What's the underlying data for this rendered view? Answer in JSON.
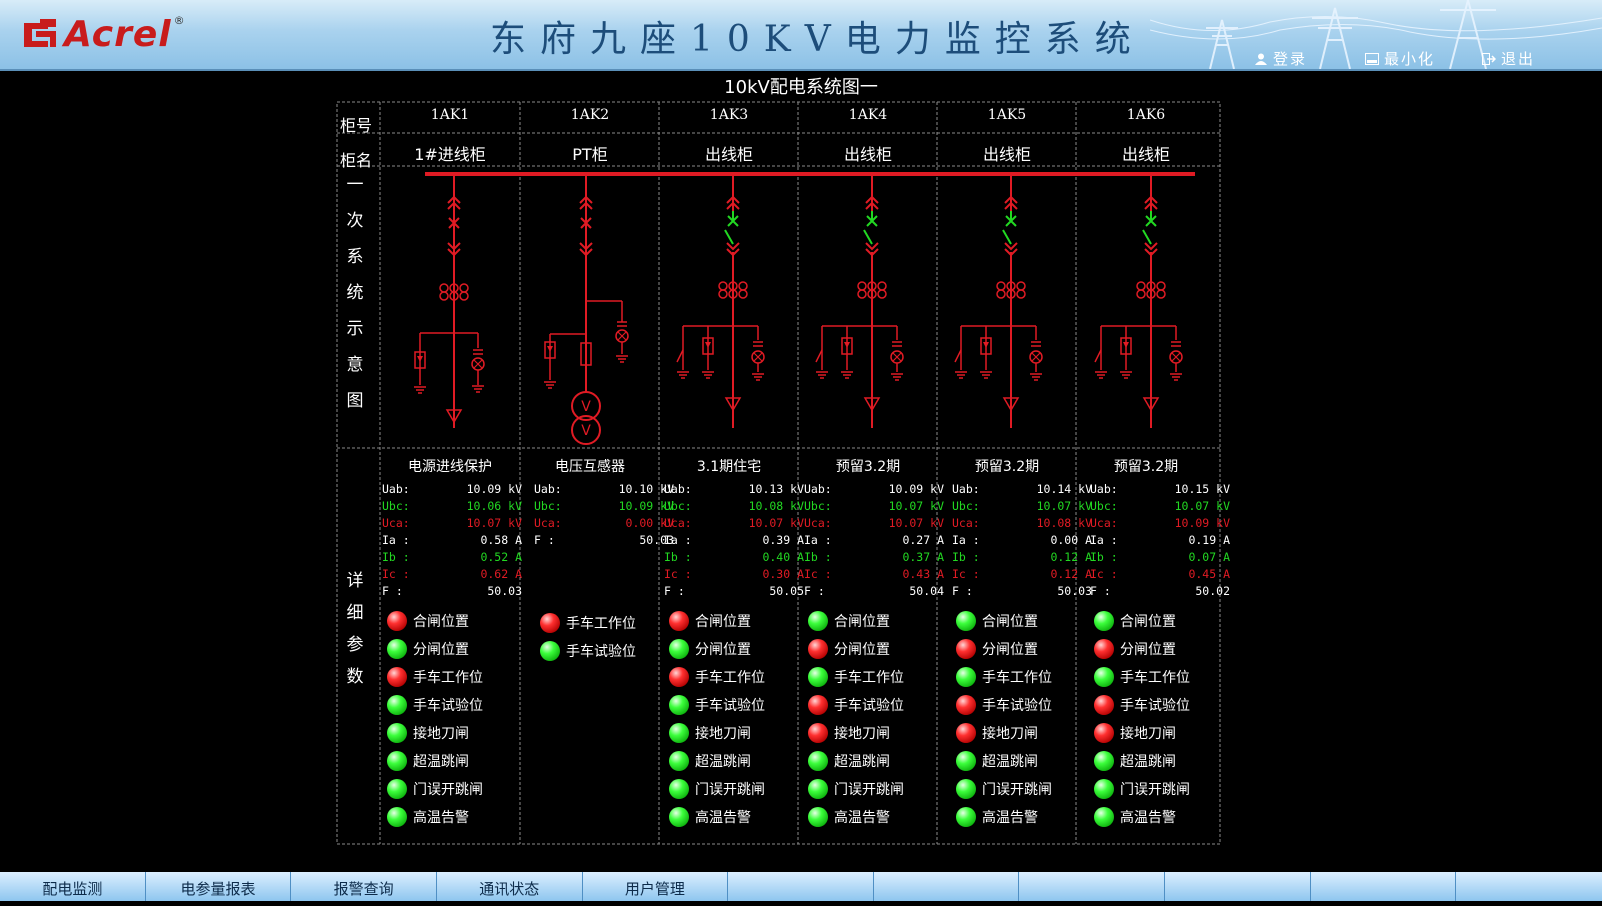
{
  "header": {
    "brand": "Acrel",
    "brand_mark": "®",
    "title": "东府九座10KV电力监控系统",
    "buttons": [
      {
        "label": "登录",
        "icon": "user-icon"
      },
      {
        "label": "最小化",
        "icon": "minimize-icon"
      },
      {
        "label": "退出",
        "icon": "exit-icon"
      }
    ]
  },
  "page_title": "10kV配电系统图一",
  "row_labels": {
    "cabinet_no": "柜号",
    "cabinet_name": "柜名",
    "primary_diagram": [
      "一",
      "次",
      "系",
      "统",
      "示",
      "意",
      "图"
    ],
    "details": [
      "详",
      "细",
      "参",
      "数"
    ]
  },
  "colors": {
    "red": "#e01b24",
    "green": "#22d822",
    "white": "#ffffff",
    "grid": "#808080"
  },
  "cabinets": [
    {
      "no": "1AK1",
      "name": "1#进线柜",
      "param_title": "电源进线保护",
      "measurements": [
        {
          "label": "Uab:",
          "value": "10.09 kV",
          "color": "white"
        },
        {
          "label": "Ubc:",
          "value": "10.06 kV",
          "color": "green"
        },
        {
          "label": "Uca:",
          "value": "10.07 kV",
          "color": "red"
        },
        {
          "label": "Ia :",
          "value": "0.58 A",
          "color": "white"
        },
        {
          "label": "Ib :",
          "value": "0.52 A",
          "color": "green"
        },
        {
          "label": "Ic :",
          "value": "0.62 A",
          "color": "red"
        },
        {
          "label": "F :",
          "value": "50.03",
          "color": "white"
        }
      ],
      "statuses": [
        {
          "label": "合闸位置",
          "state": "red"
        },
        {
          "label": "分闸位置",
          "state": "green"
        },
        {
          "label": "手车工作位",
          "state": "red"
        },
        {
          "label": "手车试验位",
          "state": "green"
        },
        {
          "label": "接地刀闸",
          "state": "green"
        },
        {
          "label": "超温跳闸",
          "state": "green"
        },
        {
          "label": "门误开跳闸",
          "state": "green"
        },
        {
          "label": "高温告警",
          "state": "green"
        }
      ]
    },
    {
      "no": "1AK2",
      "name": "PT柜",
      "param_title": "电压互感器",
      "measurements": [
        {
          "label": "Uab:",
          "value": "10.10 kV",
          "color": "white"
        },
        {
          "label": "Ubc:",
          "value": "10.09 kV",
          "color": "green"
        },
        {
          "label": "Uca:",
          "value": "0.00 kV",
          "color": "red"
        },
        {
          "label": "F :",
          "value": "50.03",
          "color": "white"
        }
      ],
      "statuses": [
        {
          "label": "手车工作位",
          "state": "red"
        },
        {
          "label": "手车试验位",
          "state": "green"
        }
      ]
    },
    {
      "no": "1AK3",
      "name": "出线柜",
      "param_title": "3.1期住宅",
      "measurements": [
        {
          "label": "Uab:",
          "value": "10.13 kV",
          "color": "white"
        },
        {
          "label": "Ubc:",
          "value": "10.08 kV",
          "color": "green"
        },
        {
          "label": "Uca:",
          "value": "10.07 kV",
          "color": "red"
        },
        {
          "label": "Ia :",
          "value": "0.39 A",
          "color": "white"
        },
        {
          "label": "Ib :",
          "value": "0.40 A",
          "color": "green"
        },
        {
          "label": "Ic :",
          "value": "0.30 A",
          "color": "red"
        },
        {
          "label": "F :",
          "value": "50.05",
          "color": "white"
        }
      ],
      "statuses": [
        {
          "label": "合闸位置",
          "state": "red"
        },
        {
          "label": "分闸位置",
          "state": "green"
        },
        {
          "label": "手车工作位",
          "state": "red"
        },
        {
          "label": "手车试验位",
          "state": "green"
        },
        {
          "label": "接地刀闸",
          "state": "green"
        },
        {
          "label": "超温跳闸",
          "state": "green"
        },
        {
          "label": "门误开跳闸",
          "state": "green"
        },
        {
          "label": "高温告警",
          "state": "green"
        }
      ]
    },
    {
      "no": "1AK4",
      "name": "出线柜",
      "param_title": "预留3.2期",
      "measurements": [
        {
          "label": "Uab:",
          "value": "10.09 kV",
          "color": "white"
        },
        {
          "label": "Ubc:",
          "value": "10.07 kV",
          "color": "green"
        },
        {
          "label": "Uca:",
          "value": "10.07 kV",
          "color": "red"
        },
        {
          "label": "Ia :",
          "value": "0.27 A",
          "color": "white"
        },
        {
          "label": "Ib :",
          "value": "0.37 A",
          "color": "green"
        },
        {
          "label": "Ic :",
          "value": "0.43 A",
          "color": "red"
        },
        {
          "label": "F :",
          "value": "50.04",
          "color": "white"
        }
      ],
      "statuses": [
        {
          "label": "合闸位置",
          "state": "green"
        },
        {
          "label": "分闸位置",
          "state": "red"
        },
        {
          "label": "手车工作位",
          "state": "green"
        },
        {
          "label": "手车试验位",
          "state": "red"
        },
        {
          "label": "接地刀闸",
          "state": "red"
        },
        {
          "label": "超温跳闸",
          "state": "green"
        },
        {
          "label": "门误开跳闸",
          "state": "green"
        },
        {
          "label": "高温告警",
          "state": "green"
        }
      ]
    },
    {
      "no": "1AK5",
      "name": "出线柜",
      "param_title": "预留3.2期",
      "measurements": [
        {
          "label": "Uab:",
          "value": "10.14 kV",
          "color": "white"
        },
        {
          "label": "Ubc:",
          "value": "10.07 kV",
          "color": "green"
        },
        {
          "label": "Uca:",
          "value": "10.08 kV",
          "color": "red"
        },
        {
          "label": "Ia :",
          "value": "0.00 A",
          "color": "white"
        },
        {
          "label": "Ib :",
          "value": "0.12 A",
          "color": "green"
        },
        {
          "label": "Ic :",
          "value": "0.12 A",
          "color": "red"
        },
        {
          "label": "F :",
          "value": "50.03",
          "color": "white"
        }
      ],
      "statuses": [
        {
          "label": "合闸位置",
          "state": "green"
        },
        {
          "label": "分闸位置",
          "state": "red"
        },
        {
          "label": "手车工作位",
          "state": "green"
        },
        {
          "label": "手车试验位",
          "state": "red"
        },
        {
          "label": "接地刀闸",
          "state": "red"
        },
        {
          "label": "超温跳闸",
          "state": "green"
        },
        {
          "label": "门误开跳闸",
          "state": "green"
        },
        {
          "label": "高温告警",
          "state": "green"
        }
      ]
    },
    {
      "no": "1AK6",
      "name": "出线柜",
      "param_title": "预留3.2期",
      "measurements": [
        {
          "label": "Uab:",
          "value": "10.15 kV",
          "color": "white"
        },
        {
          "label": "Ubc:",
          "value": "10.07 kV",
          "color": "green"
        },
        {
          "label": "Uca:",
          "value": "10.09 kV",
          "color": "red"
        },
        {
          "label": "Ia :",
          "value": "0.19 A",
          "color": "white"
        },
        {
          "label": "Ib :",
          "value": "0.07 A",
          "color": "green"
        },
        {
          "label": "Ic :",
          "value": "0.45 A",
          "color": "red"
        },
        {
          "label": "F :",
          "value": "50.02",
          "color": "white"
        }
      ],
      "statuses": [
        {
          "label": "合闸位置",
          "state": "green"
        },
        {
          "label": "分闸位置",
          "state": "red"
        },
        {
          "label": "手车工作位",
          "state": "green"
        },
        {
          "label": "手车试验位",
          "state": "red"
        },
        {
          "label": "接地刀闸",
          "state": "red"
        },
        {
          "label": "超温跳闸",
          "state": "green"
        },
        {
          "label": "门误开跳闸",
          "state": "green"
        },
        {
          "label": "高温告警",
          "state": "green"
        }
      ]
    }
  ],
  "bottom_tabs": [
    "配电监测",
    "电参量报表",
    "报警查询",
    "通讯状态",
    "用户管理",
    "",
    "",
    "",
    "",
    "",
    ""
  ]
}
